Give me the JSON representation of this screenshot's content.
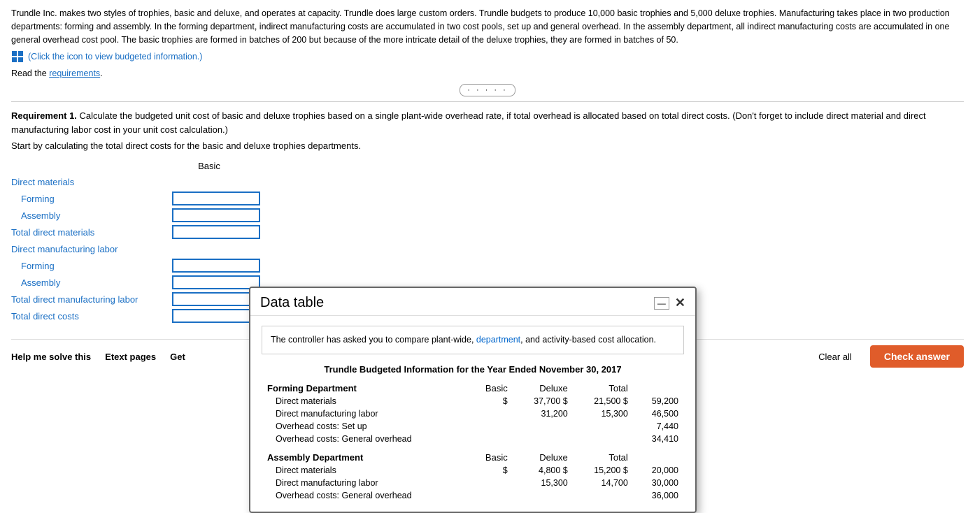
{
  "intro": {
    "paragraph": "Trundle Inc. makes two styles of trophies, basic and deluxe, and operates at capacity. Trundle does large custom orders. Trundle budgets to produce 10,000 basic trophies and 5,000 deluxe trophies. Manufacturing takes place in two production departments: forming and assembly. In the forming department, indirect manufacturing costs are accumulated in two cost pools, set up and general overhead. In the assembly department, all indirect manufacturing costs are accumulated in one general overhead cost pool. The basic trophies are formed in batches of 200 but because of the more intricate detail of the deluxe trophies, they are formed in batches of 50.",
    "icon_text": "(Click the icon to view budgeted information.)",
    "read_req_prefix": "Read the ",
    "read_req_link": "requirements",
    "read_req_suffix": "."
  },
  "requirement": {
    "label": "Requirement 1.",
    "text": " Calculate the budgeted unit cost of basic and deluxe trophies based on a single plant-wide overhead rate, if total overhead is allocated based on total direct costs. (Don't forget to include direct material and direct manufacturing labor cost in your unit cost calculation.)"
  },
  "start_text": "Start by calculating the total direct costs for the basic and deluxe trophies departments.",
  "left_table": {
    "col_header": "Basic",
    "sections": [
      {
        "label": "Direct materials",
        "type": "section"
      },
      {
        "label": "Forming",
        "type": "indent",
        "has_input": true
      },
      {
        "label": "Assembly",
        "type": "indent",
        "has_input": true
      },
      {
        "label": "Total direct materials",
        "type": "section",
        "has_input": true
      },
      {
        "label": "Direct manufacturing labor",
        "type": "section"
      },
      {
        "label": "Forming",
        "type": "indent",
        "has_input": true
      },
      {
        "label": "Assembly",
        "type": "indent",
        "has_input": true
      },
      {
        "label": "Total direct manufacturing labor",
        "type": "section",
        "has_input": true
      },
      {
        "label": "Total direct costs",
        "type": "section",
        "has_input": true
      }
    ]
  },
  "modal": {
    "title": "Data table",
    "notice": "The controller has asked you to compare plant-wide, department, and activity-based cost allocation.",
    "notice_highlight": "department",
    "table_title": "Trundle Budgeted Information for the Year Ended November 30, 2017",
    "forming_dept": {
      "label": "Forming Department",
      "cols": [
        "Basic",
        "Deluxe",
        "Total"
      ],
      "rows": [
        {
          "label": "Direct materials",
          "dollar": "$",
          "basic": "37,700",
          "deluxe": "21,500",
          "total": "59,200",
          "dollar_suffix": "$"
        },
        {
          "label": "Direct manufacturing labor",
          "dollar": "",
          "basic": "31,200",
          "deluxe": "15,300",
          "total": "46,500"
        },
        {
          "label": "Overhead costs: Set up",
          "dollar": "",
          "basic": "",
          "deluxe": "",
          "total": "7,440"
        },
        {
          "label": "Overhead costs: General overhead",
          "dollar": "",
          "basic": "",
          "deluxe": "",
          "total": "34,410"
        }
      ]
    },
    "assembly_dept": {
      "label": "Assembly Department",
      "cols": [
        "Basic",
        "Deluxe",
        "Total"
      ],
      "rows": [
        {
          "label": "Direct materials",
          "dollar": "$",
          "basic": "4,800",
          "deluxe": "15,200",
          "total": "20,000",
          "dollar_suffix": "$"
        },
        {
          "label": "Direct manufacturing labor",
          "dollar": "",
          "basic": "15,300",
          "deluxe": "14,700",
          "total": "30,000"
        },
        {
          "label": "Overhead costs: General overhead",
          "dollar": "",
          "basic": "",
          "deluxe": "",
          "total": "36,000"
        }
      ]
    }
  },
  "bottom": {
    "help_label": "Help me solve this",
    "etext_label": "Etext pages",
    "get_label": "Get",
    "clear_label": "Clear all",
    "check_label": "Check answer"
  }
}
